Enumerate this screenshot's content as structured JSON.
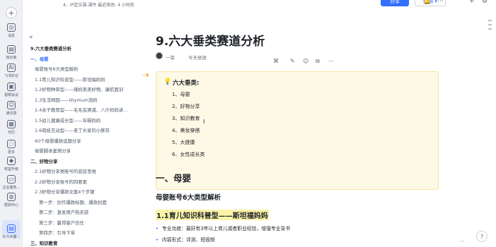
{
  "rail": {
    "items": [
      {
        "icon": "home-icon",
        "label": "消息",
        "glyph": "◎"
      },
      {
        "icon": "knowledge-icon",
        "label": "知识库",
        "glyph": "▤"
      },
      {
        "icon": "ai-icon",
        "label": "飞书妙记",
        "glyph": "Ai"
      },
      {
        "icon": "video-icon",
        "label": "视频会议",
        "glyph": "▣"
      },
      {
        "icon": "contacts-icon",
        "label": "通讯录",
        "glyph": "☺"
      },
      {
        "icon": "calendar-icon",
        "label": "日历",
        "glyph": "▦"
      },
      {
        "icon": "more-icon",
        "label": "更多",
        "glyph": "◌"
      },
      {
        "icon": "upgrade-icon",
        "label": "权益升级",
        "glyph": "◆"
      },
      {
        "icon": "enterprise-icon",
        "label": "企业服务...",
        "glyph": "▭"
      },
      {
        "icon": "help-center-icon",
        "label": "帮助中心",
        "glyph": "◍"
      }
    ],
    "active_item_label": "9.六大垂..."
  },
  "topbar": {
    "breadcrumb": "4、IP定位课-课件      最近修改: 4 小时前",
    "share_label": "分享",
    "edit_label": "编辑",
    "icons": [
      "bell-icon",
      "more-icon",
      "plus-icon",
      "settings-icon"
    ]
  },
  "toc": {
    "items": [
      {
        "level": "l0",
        "text": "9.六大垂类赛道分析"
      },
      {
        "level": "l1",
        "text": "一、母婴",
        "active": true
      },
      {
        "level": "l2",
        "text": "母婴账号6大类型解析"
      },
      {
        "level": "l3",
        "text": "1.1育儿知识科普型——斯坦福妈妈"
      },
      {
        "level": "l3",
        "text": "1.2好物种草型——辣妈美美好物、康航面训"
      },
      {
        "level": "l3",
        "text": "1.3生活网园——lillymum泡妈"
      },
      {
        "level": "l3",
        "text": "1.4亲子教育型——毛毛虫爽道、八斤妈妈讲..."
      },
      {
        "level": "l3",
        "text": "1.5幼儿健康成长型——年糕妈妈"
      },
      {
        "level": "l3",
        "text": "1.6萌娃互动型——老丁头家的小胖苏"
      },
      {
        "level": "l2",
        "text": "60个母婴爆款选题分享"
      },
      {
        "level": "l2",
        "text": "母婴脚本案例分享"
      },
      {
        "level": "l1",
        "text": "二、好物分享"
      },
      {
        "level": "l2",
        "text": "2.1好物分享类账号的底层思维"
      },
      {
        "level": "l2",
        "text": "2.2好物分享账号的四要素"
      },
      {
        "level": "l2",
        "text": "2.3好物分享爆款文案4个步骤"
      },
      {
        "level": "l3",
        "text": "第一步：创作爆款标题、爆款封面"
      },
      {
        "level": "l3",
        "text": "第二步：激发用户购买欲"
      },
      {
        "level": "l3",
        "text": "第三步：赢得客户信任"
      },
      {
        "level": "l3",
        "text": "第四步：引导下单"
      },
      {
        "level": "l1",
        "text": "三、知识教育"
      }
    ]
  },
  "doc": {
    "title": "9.六大垂类赛道分析",
    "author": "一菲",
    "modified": "今天修改",
    "callout": {
      "title": "六大垂类:",
      "items": [
        "1、母婴",
        "2、好物分享",
        "3、知识教育",
        "4、美妆穿搭",
        "5、大健康",
        "6、女性成长类"
      ]
    },
    "h1": "一、母婴",
    "h2": "母婴账号6大类型解析",
    "h3": "1.1育儿知识科普型——斯坦福妈妈",
    "bullets": [
      "专业功底：最好有3年以上育儿或者职业经验，增强专业背书",
      "内容形式：评测、短视频"
    ]
  }
}
